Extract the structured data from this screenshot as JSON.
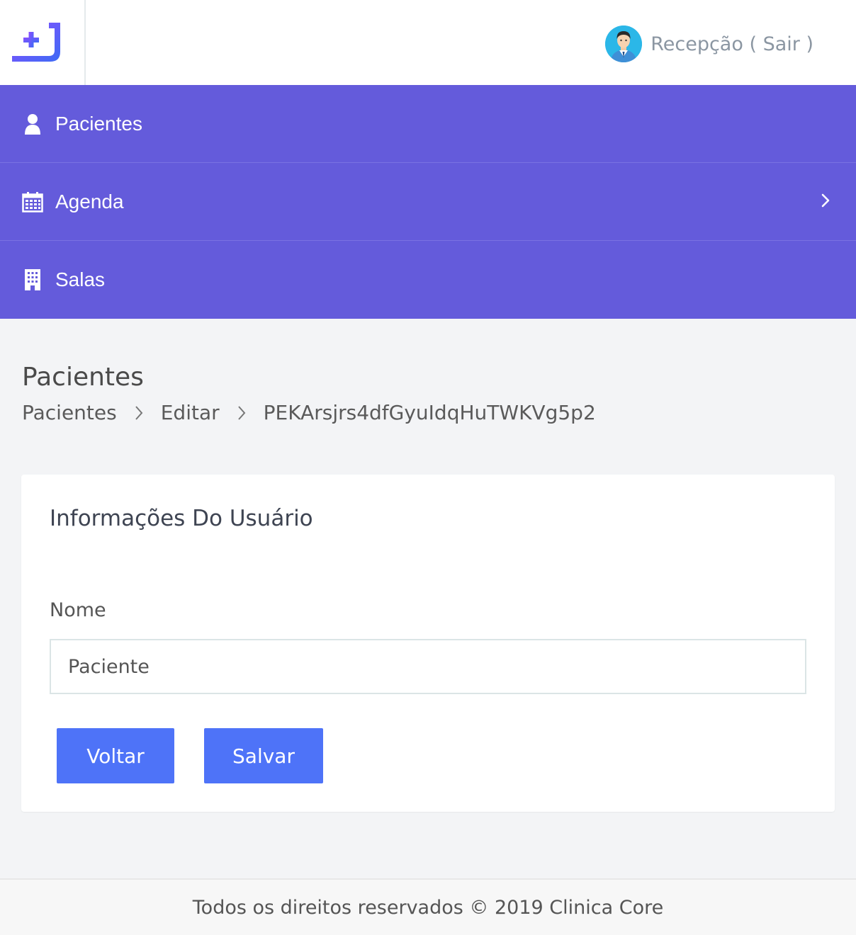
{
  "header": {
    "user_name": "Recepção",
    "logout_label": "( Sair )"
  },
  "nav": {
    "items": [
      {
        "label": "Pacientes",
        "icon": "user-icon"
      },
      {
        "label": "Agenda",
        "icon": "calendar-icon",
        "has_submenu": true
      },
      {
        "label": "Salas",
        "icon": "building-icon"
      }
    ]
  },
  "page": {
    "title": "Pacientes",
    "breadcrumb": [
      "Pacientes",
      "Editar",
      "PEKArsjrs4dfGyuIdqHuTWKVg5p2"
    ]
  },
  "card": {
    "title": "Informações Do Usuário",
    "name_label": "Nome",
    "name_value": "Paciente",
    "back_label": "Voltar",
    "save_label": "Salvar"
  },
  "footer": {
    "text": "Todos os direitos reservados © 2019 Clinica Core"
  },
  "colors": {
    "nav_bg": "#645bdb",
    "button": "#4e73f8",
    "logo_gradient_start": "#7b4dff",
    "logo_gradient_end": "#3b6cf5"
  }
}
